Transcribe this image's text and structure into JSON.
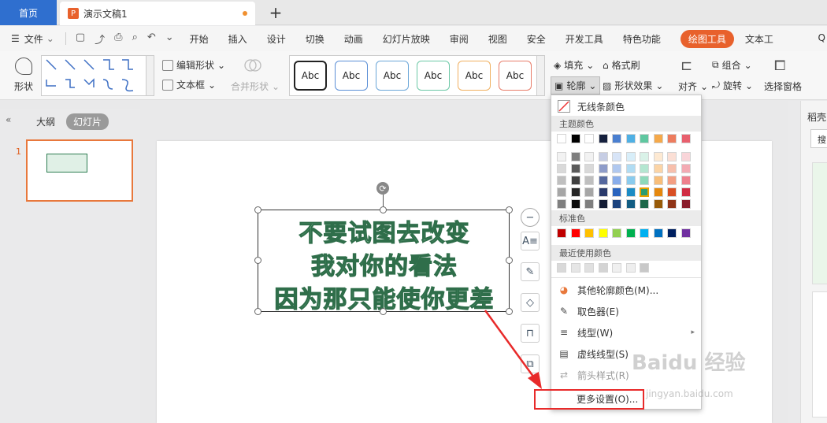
{
  "tabs": {
    "home": "首页",
    "doc": "演示文稿1",
    "add": "+"
  },
  "menu": {
    "file": "文件",
    "items": [
      "开始",
      "插入",
      "设计",
      "切换",
      "动画",
      "幻灯片放映",
      "审阅",
      "视图",
      "安全",
      "开发工具",
      "特色功能"
    ],
    "active": "绘图工具",
    "text_tool": "文本工",
    "search": "Q"
  },
  "ribbon": {
    "shape": "形状",
    "edit_shape": "编辑形状",
    "text_box": "文本框",
    "merge_shape": "合并形状",
    "style_samples": [
      "Abc",
      "Abc",
      "Abc",
      "Abc",
      "Abc",
      "Abc"
    ],
    "style_colors": [
      "#222222",
      "#5b8fd6",
      "#6ba6d8",
      "#6cc8a6",
      "#f0b060",
      "#e87d6a"
    ],
    "fill": "填充",
    "format_brush": "格式刷",
    "outline": "轮廓",
    "shape_effect": "形状效果",
    "align": "对齐",
    "group": "组合",
    "rotate": "旋转",
    "select_pane": "选择窗格"
  },
  "left_panel": {
    "collapse": "«",
    "outline": "大纲",
    "slides": "幻灯片",
    "slide_number": "1"
  },
  "slide": {
    "lines": [
      "不要试图去改变",
      "我对你的看法",
      "因为那只能使你更差"
    ],
    "text_fill": "#86c9a0",
    "text_outline": "#2f6e4a"
  },
  "right_panel": {
    "title": "稻壳",
    "search": "搜"
  },
  "dropdown": {
    "no_line": "无线条颜色",
    "theme_header": "主题颜色",
    "theme_row1": [
      "#ffffff",
      "#000000",
      "#ffffff",
      "#16213e",
      "#4a7fd0",
      "#4fb0e4",
      "#5fc7a0",
      "#f5a94a",
      "#ed7c5e",
      "#e85f6d"
    ],
    "theme_shades": [
      [
        "#f2f2f2",
        "#7f7f7f",
        "#f2f2f2",
        "#c6cde4",
        "#d7e4f7",
        "#d8eef9",
        "#d9f2e8",
        "#fde9d2",
        "#fbdfd5",
        "#f9d5d9"
      ],
      [
        "#d9d9d9",
        "#595959",
        "#d9d9d9",
        "#8e9cc9",
        "#b0c8ef",
        "#b1dcf3",
        "#b4e6d1",
        "#fbd4a6",
        "#f7bfac",
        "#f3aab3"
      ],
      [
        "#bfbfbf",
        "#404040",
        "#bfbfbf",
        "#55689e",
        "#89adea",
        "#8acbee",
        "#8ed9ba",
        "#f8be7a",
        "#f39f83",
        "#ee808d"
      ],
      [
        "#a6a6a6",
        "#262626",
        "#a6a6a6",
        "#2a3a6b",
        "#2a64be",
        "#1b8bc4",
        "#2d9c70",
        "#e5880e",
        "#d84f24",
        "#d02c43"
      ],
      [
        "#7f7f7f",
        "#0d0d0d",
        "#7f7f7f",
        "#141d35",
        "#1c437e",
        "#125d83",
        "#1e684b",
        "#985b09",
        "#903518",
        "#8a1d2c"
      ]
    ],
    "standard_header": "标准色",
    "standard": [
      "#c00000",
      "#ff0000",
      "#ffc000",
      "#ffff00",
      "#92d050",
      "#00b050",
      "#00b0f0",
      "#0070c0",
      "#002060",
      "#7030a0"
    ],
    "recent_header": "最近使用颜色",
    "recent": [
      "#d9d9d9",
      "#e6e6e6",
      "#e0e0e0",
      "#d4d4d4",
      "#f0f0f0",
      "#eeeeee",
      "#c8c8c8"
    ],
    "other_color": "其他轮廓颜色(M)...",
    "eyedropper": "取色器(E)",
    "line_type": "线型(W)",
    "dash_type": "虚线线型(S)",
    "arrow_style": "箭头样式(R)",
    "more_settings": "更多设置(O)..."
  },
  "watermark": {
    "main": "Baidu 经验",
    "sub": "jingyan.baidu.com"
  }
}
